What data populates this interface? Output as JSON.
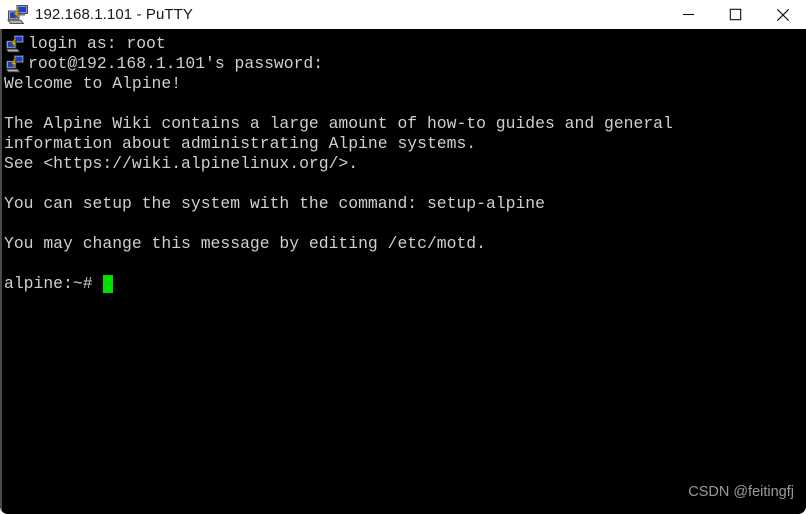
{
  "window": {
    "title": "192.168.1.101 - PuTTY",
    "icon": "putty-icon",
    "controls": {
      "minimize": "minimize-icon",
      "maximize": "maximize-icon",
      "close": "close-icon"
    },
    "titlebar_bg": "#ffffff",
    "title_color": "#1a1a1a"
  },
  "terminal": {
    "background": "#000000",
    "foreground": "#cfcfcf",
    "cursor_color": "#00e000",
    "lines": [
      {
        "text": "login as: root",
        "indent": true
      },
      {
        "text": "root@192.168.1.101's password:",
        "indent": true
      },
      {
        "text": "Welcome to Alpine!",
        "indent": false
      },
      {
        "text": "",
        "indent": false
      },
      {
        "text": "The Alpine Wiki contains a large amount of how-to guides and general",
        "indent": false
      },
      {
        "text": "information about administrating Alpine systems.",
        "indent": false
      },
      {
        "text": "See <https://wiki.alpinelinux.org/>.",
        "indent": false
      },
      {
        "text": "",
        "indent": false
      },
      {
        "text": "You can setup the system with the command: setup-alpine",
        "indent": false
      },
      {
        "text": "",
        "indent": false
      },
      {
        "text": "You may change this message by editing /etc/motd.",
        "indent": false
      },
      {
        "text": "",
        "indent": false
      }
    ],
    "prompt": "alpine:~#"
  },
  "watermark": {
    "text": "CSDN @feitingfj",
    "color": "#9a9a9a"
  }
}
